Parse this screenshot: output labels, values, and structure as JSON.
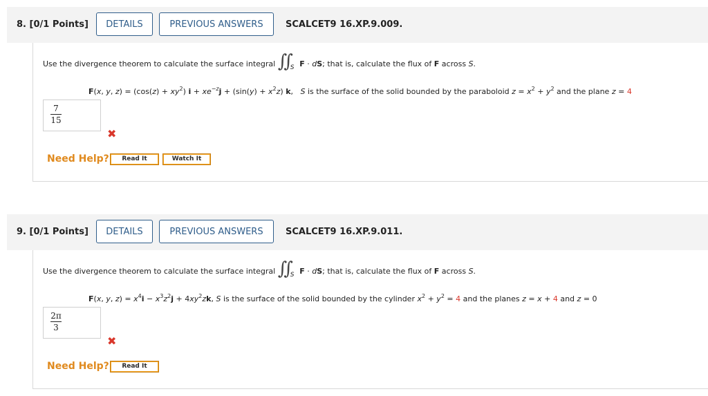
{
  "questions": [
    {
      "number": "8.",
      "points": "[0/1 Points]",
      "details_label": "DETAILS",
      "previous_label": "PREVIOUS ANSWERS",
      "ref": "SCALCET9 16.XP.9.009.",
      "instruction_pre": "Use the divergence theorem to calculate the surface integral",
      "integral_sub": "S",
      "instruction_post_bold": "F",
      "instruction_post": " · dS; that is, calculate the flux of F across S.",
      "answer_num": "7",
      "answer_den": "15",
      "need_help": "Need Help?",
      "read_label": "Read It",
      "watch_label": "Watch It",
      "plane_value": "4"
    },
    {
      "number": "9.",
      "points": "[0/1 Points]",
      "details_label": "DETAILS",
      "previous_label": "PREVIOUS ANSWERS",
      "ref": "SCALCET9 16.XP.9.011.",
      "instruction_pre": "Use the divergence theorem to calculate the surface integral",
      "integral_sub": "S",
      "instruction_post_bold": "F",
      "instruction_post": " · dS; that is, calculate the flux of F across S.",
      "answer_num": "2π",
      "answer_den": "3",
      "need_help": "Need Help?",
      "read_label": "Read It",
      "cyl_value": "4",
      "plane_value": "4"
    }
  ],
  "colors": {
    "link": "#2f5d8a",
    "error": "#d9372b",
    "help": "#e08a1e"
  }
}
